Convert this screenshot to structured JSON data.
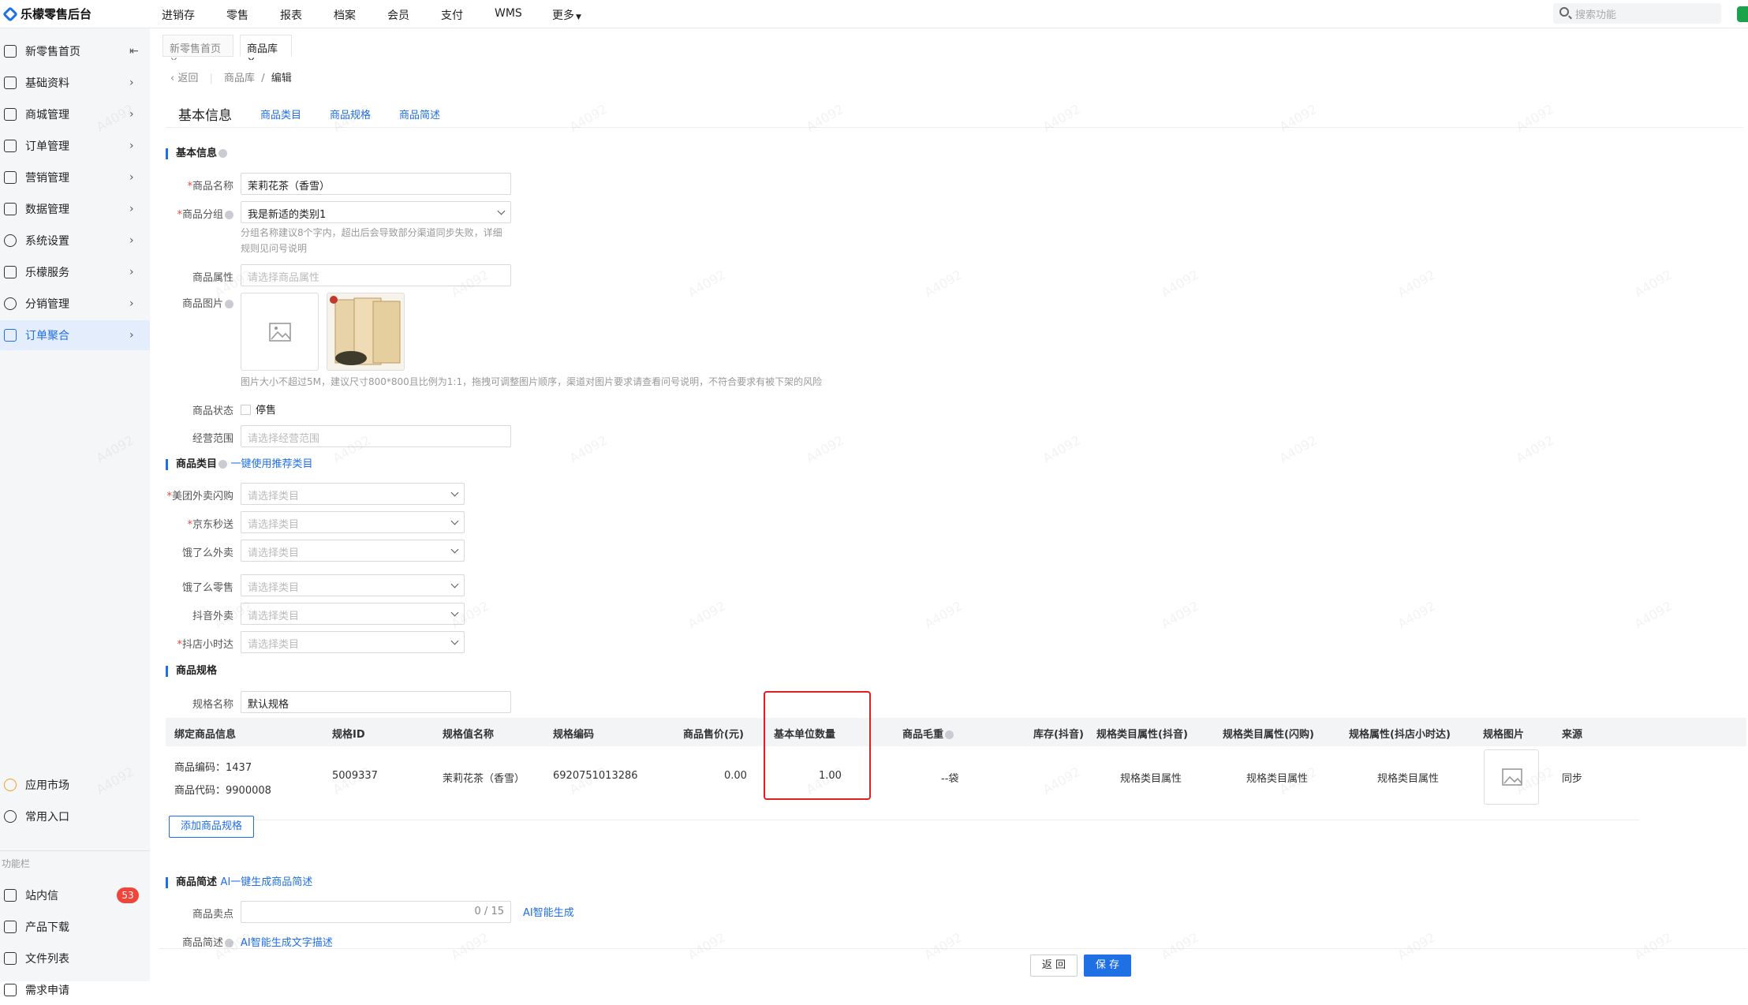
{
  "app": {
    "title": "乐檬零售后台"
  },
  "topnav": [
    "进销存",
    "零售",
    "报表",
    "档案",
    "会员",
    "支付",
    "WMS",
    "更多"
  ],
  "search": {
    "placeholder": "搜索功能"
  },
  "sidebar": {
    "items": [
      {
        "label": "新零售首页",
        "icon": "home-icon"
      },
      {
        "label": "基础资料",
        "icon": "grid-icon"
      },
      {
        "label": "商城管理",
        "icon": "shop-icon"
      },
      {
        "label": "订单管理",
        "icon": "order-icon"
      },
      {
        "label": "营销管理",
        "icon": "marketing-icon"
      },
      {
        "label": "数据管理",
        "icon": "chart-icon"
      },
      {
        "label": "系统设置",
        "icon": "gear-icon"
      },
      {
        "label": "乐檬服务",
        "icon": "service-icon"
      },
      {
        "label": "分销管理",
        "icon": "distribution-icon"
      },
      {
        "label": "订单聚合",
        "icon": "order-aggregate-icon"
      }
    ],
    "bottom": [
      {
        "label": "应用市场",
        "icon": "app-market-icon"
      },
      {
        "label": "常用入口",
        "icon": "heart-icon"
      }
    ],
    "section_label": "功能栏",
    "tools": [
      {
        "label": "站内信",
        "icon": "message-icon",
        "badge": "53"
      },
      {
        "label": "产品下载",
        "icon": "download-icon"
      },
      {
        "label": "文件列表",
        "icon": "file-list-icon"
      },
      {
        "label": "需求申请",
        "icon": "request-icon"
      }
    ]
  },
  "tabs": [
    "新零售首页",
    "商品库"
  ],
  "breadcrumb": {
    "back": "返回",
    "path1": "商品库",
    "sep": "/",
    "path2": "编辑"
  },
  "anchors": {
    "active": "基本信息",
    "links": [
      "商品类目",
      "商品规格",
      "商品简述"
    ]
  },
  "basic": {
    "section": "基本信息",
    "name_label": "商品名称",
    "name_value": "茉莉花茶（香雪）",
    "group_label": "商品分组",
    "group_value": "我是新适的类别1",
    "group_hint": "分组名称建议8个字内，超出后会导致部分渠道同步失败，详细规则见问号说明",
    "attr_label": "商品属性",
    "attr_placeholder": "请选择商品属性",
    "image_label": "商品图片",
    "image_hint": "图片大小不超过5M，建议尺寸800*800且比例为1:1，拖拽可调整图片顺序，渠道对图片要求请查看问号说明，不符合要求有被下架的风险",
    "status_label": "商品状态",
    "status_option": "停售",
    "scope_label": "经营范围",
    "scope_placeholder": "请选择经营范围"
  },
  "category": {
    "section": "商品类目",
    "recommend_link": "一键使用推荐类目",
    "placeholder": "请选择类目",
    "rows": [
      {
        "label": "美团外卖闪购",
        "required": true
      },
      {
        "label": "京东秒送",
        "required": true
      },
      {
        "label": "饿了么外卖",
        "required": false
      },
      {
        "label": "饿了么零售",
        "required": false
      },
      {
        "label": "抖音外卖",
        "required": false
      },
      {
        "label": "抖店小时达",
        "required": true
      }
    ]
  },
  "spec": {
    "section": "商品规格",
    "name_label": "规格名称",
    "name_value": "默认规格",
    "headers": [
      "绑定商品信息",
      "规格ID",
      "规格值名称",
      "规格编码",
      "商品售价(元)",
      "基本单位数量",
      "商品毛重",
      "库存(抖音)",
      "规格类目属性(抖音)",
      "规格类目属性(闪购)",
      "规格属性(抖店小时达)",
      "规格图片",
      "来源"
    ],
    "row": {
      "code_line": "商品编码：1437",
      "sku_line": "商品代码：9900008",
      "spec_id": "5009337",
      "value_name": "茉莉花茶（香雪）",
      "spec_code": "6920751013286",
      "price": "0.00",
      "unit_qty": "1.00",
      "weight": "--袋",
      "attr_douyin": "规格类目属性",
      "attr_shangou": "规格类目属性",
      "attr_dd": "规格类目属性",
      "source": "同步"
    },
    "add_button": "添加商品规格"
  },
  "desc": {
    "section": "商品简述",
    "ai_link": "AI一键生成商品简述",
    "selling_label": "商品卖点",
    "selling_count": "0 / 15",
    "ai_gen": "AI智能生成",
    "desc_label": "商品简述",
    "desc_link": "AI智能生成文字描述"
  },
  "footer": {
    "back": "返 回",
    "save": "保 存"
  },
  "watermark": "A4092",
  "colors": {
    "accent": "#1f6fe5",
    "highlight_box": "#e02020",
    "badge": "#f0453a"
  }
}
